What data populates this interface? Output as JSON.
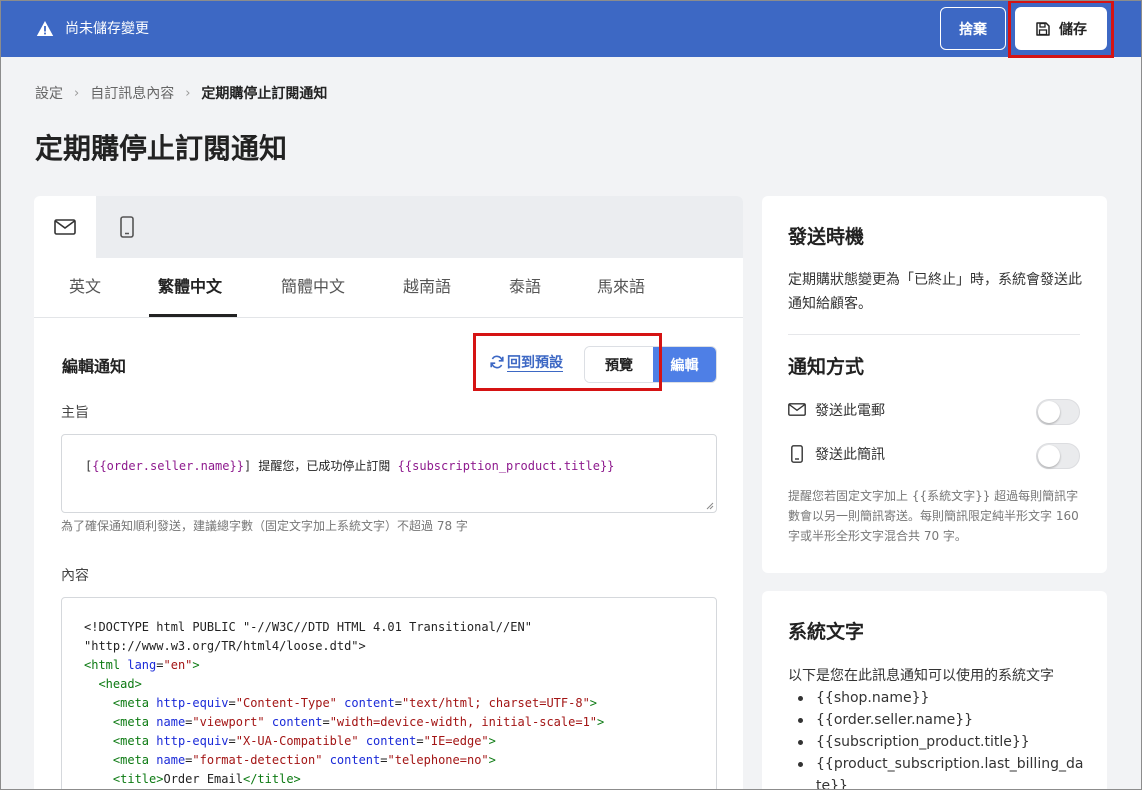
{
  "topbar": {
    "unsaved_text": "尚未儲存變更",
    "discard_label": "捨棄",
    "save_label": "儲存",
    "accent": "#3d68c4"
  },
  "breadcrumb": {
    "items": [
      "設定",
      "自訂訊息內容",
      "定期購停止訂閱通知"
    ]
  },
  "page_title": "定期購停止訂閱通知",
  "channel_tabs": {
    "email_icon": "mail-icon",
    "sms_icon": "mobile-icon"
  },
  "language_tabs": [
    "英文",
    "繁體中文",
    "簡體中文",
    "越南語",
    "泰語",
    "馬來語"
  ],
  "active_language": "繁體中文",
  "editor": {
    "heading": "編輯通知",
    "reset_label": "回到預設",
    "preview_label": "預覽",
    "edit_label": "編輯",
    "subject_label": "主旨",
    "subject": {
      "open": "[",
      "var1": "{{order.seller.name}}",
      "close": "]",
      "text": "提醒您，已成功停止訂閱",
      "var2": "{{subscription_product.title}}"
    },
    "subject_hint": "為了確保通知順利發送，建議總字數（固定文字加上系統文字）不超過 78 字",
    "content_label": "內容",
    "code": {
      "l1": "<!DOCTYPE html PUBLIC \"-//W3C//DTD HTML 4.01 Transitional//EN\"",
      "l2": "\"http://www.w3.org/TR/html4/loose.dtd\">",
      "l3": {
        "tag_open": "<html ",
        "attr": "lang",
        "eq": "=",
        "val": "\"en\"",
        "tag_close": ">"
      },
      "l4": "<head>",
      "metas": [
        {
          "a1": "http-equiv",
          "v1": "\"Content-Type\"",
          "a2": "content",
          "v2": "\"text/html; charset=UTF-8\""
        },
        {
          "a1": "name",
          "v1": "\"viewport\"",
          "a2": "content",
          "v2": "\"width=device-width, initial-scale=1\""
        },
        {
          "a1": "http-equiv",
          "v1": "\"X-UA-Compatible\"",
          "a2": "content",
          "v2": "\"IE=edge\""
        },
        {
          "a1": "name",
          "v1": "\"format-detection\"",
          "a2": "content",
          "v2": "\"telephone=no\""
        }
      ],
      "meta_tag": "<meta ",
      "title_open": "<title>",
      "title_text": "Order Email",
      "title_close": "</title>"
    }
  },
  "timing": {
    "heading": "發送時機",
    "description": "定期購狀態變更為「已終止」時，系統會發送此通知給顧客。"
  },
  "notify": {
    "heading": "通知方式",
    "email_label": "發送此電郵",
    "email_enabled": false,
    "sms_label": "發送此簡訊",
    "sms_enabled": false,
    "note": "提醒您若固定文字加上 {{系統文字}} 超過每則簡訊字數會以另一則簡訊寄送。每則簡訊限定純半形文字 160 字或半形全形文字混合共 70 字。"
  },
  "system_text": {
    "heading": "系統文字",
    "intro": "以下是您在此訊息通知可以使用的系統文字",
    "items": [
      "{{shop.name}}",
      "{{order.seller.name}}",
      "{{subscription_product.title}}",
      "{{product_subscription.last_billing_date}}"
    ]
  }
}
